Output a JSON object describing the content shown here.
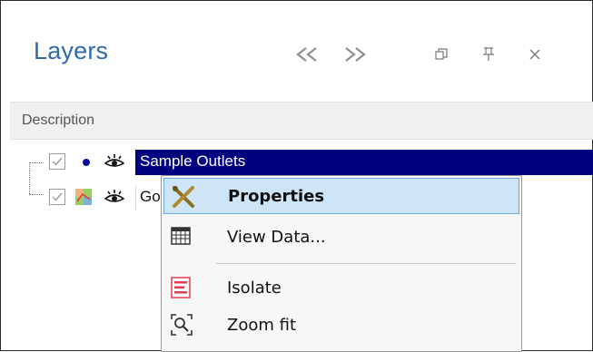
{
  "panel": {
    "title": "Layers",
    "toolbar": {
      "back_icon": "double-left-arrow-icon",
      "forward_icon": "double-right-arrow-icon",
      "float_icon": "restore-window-icon",
      "pin_icon": "pin-icon",
      "close_icon": "close-icon"
    }
  },
  "table": {
    "column_header": "Description"
  },
  "layers": [
    {
      "label": "Sample Outlets",
      "checked": true,
      "visible": true,
      "selected": true,
      "icon": "point-layer-icon"
    },
    {
      "label": "Go",
      "checked": true,
      "visible": true,
      "selected": false,
      "icon": "map-tile-layer-icon"
    }
  ],
  "context_menu": {
    "items": [
      {
        "label": "Properties",
        "icon": "tools-icon",
        "highlighted": true
      },
      {
        "label": "View Data...",
        "icon": "table-icon",
        "highlighted": false
      },
      {
        "label": "Isolate",
        "icon": "isolate-icon",
        "highlighted": false
      },
      {
        "label": "Zoom fit",
        "icon": "zoom-fit-icon",
        "highlighted": false
      }
    ]
  },
  "colors": {
    "title": "#2f6aa6",
    "selection": "#00007f",
    "menu_highlight": "#cde5f7",
    "menu_highlight_border": "#6fa9dc"
  }
}
